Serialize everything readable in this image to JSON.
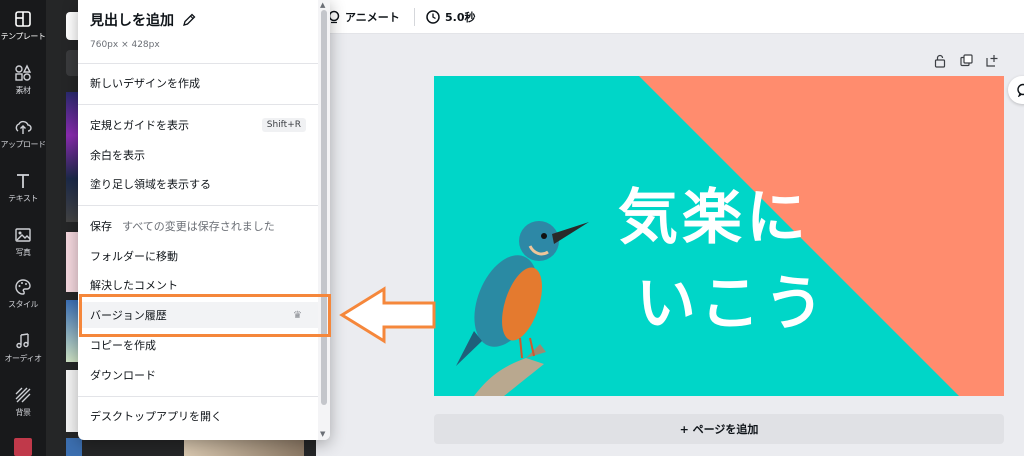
{
  "rail": {
    "items": [
      {
        "label": "テンプレート",
        "icon": "template-icon"
      },
      {
        "label": "素材",
        "icon": "elements-icon"
      },
      {
        "label": "アップロード",
        "icon": "upload-icon"
      },
      {
        "label": "テキスト",
        "icon": "text-icon"
      },
      {
        "label": "写真",
        "icon": "photo-icon"
      },
      {
        "label": "スタイル",
        "icon": "palette-icon"
      },
      {
        "label": "オーディオ",
        "icon": "music-icon"
      },
      {
        "label": "背景",
        "icon": "background-icon"
      }
    ]
  },
  "topbar": {
    "animate_label": "アニメート",
    "duration_label": "5.0秒"
  },
  "menu": {
    "title": "見出しを追加",
    "dimensions": "760px × 428px",
    "items": {
      "new_design": "新しいデザインを作成",
      "show_rulers": "定規とガイドを表示",
      "show_rulers_shortcut": "Shift+R",
      "show_margins": "余白を表示",
      "show_bleed": "塗り足し領域を表示する",
      "save": "保存",
      "save_status": "すべての変更は保存されました",
      "move_folder": "フォルダーに移動",
      "resolved_comments": "解決したコメント",
      "version_history": "バージョン履歴",
      "make_copy": "コピーを作成",
      "download": "ダウンロード",
      "open_desktop": "デスクトップアプリを開く"
    }
  },
  "canvas": {
    "line1": "気楽に",
    "line2": "いこう",
    "bg_color": "#00d6c8",
    "accent_color": "#ff8c6e"
  },
  "add_page_label": "+ ページを追加",
  "annotation_color": "#f5873b"
}
